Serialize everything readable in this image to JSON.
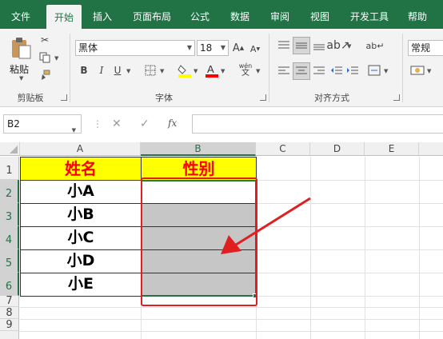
{
  "tabs": [
    "文件",
    "开始",
    "插入",
    "页面布局",
    "公式",
    "数据",
    "审阅",
    "视图",
    "开发工具",
    "帮助"
  ],
  "active_tab": 1,
  "ribbon": {
    "clipboard": {
      "paste_label": "粘贴",
      "group_label": "剪贴板"
    },
    "font": {
      "name": "黑体",
      "size": "18",
      "bold": "B",
      "italic": "I",
      "underline": "U",
      "grow": "A",
      "shrink": "A",
      "phonetic": "wén",
      "group_label": "字体"
    },
    "alignment": {
      "group_label": "对齐方式"
    },
    "number": {
      "format": "常规"
    }
  },
  "name_box": "B2",
  "formula": "",
  "formula_icons": {
    "cancel": "✕",
    "enter": "✓",
    "function": "fx"
  },
  "columns": [
    "A",
    "B",
    "C",
    "D",
    "E"
  ],
  "rows": [
    "1",
    "2",
    "3",
    "4",
    "5",
    "6",
    "7",
    "8",
    "9"
  ],
  "cells": {
    "A1": "姓名",
    "B1": "性别",
    "A2": "小A",
    "A3": "小B",
    "A4": "小C",
    "A5": "小D",
    "A6": "小E"
  },
  "colors": {
    "accent": "#217346",
    "header_fill": "#ffff00",
    "header_text": "#ff0000",
    "selection_fill": "#c6c6c6",
    "annotation": "#e02020"
  }
}
